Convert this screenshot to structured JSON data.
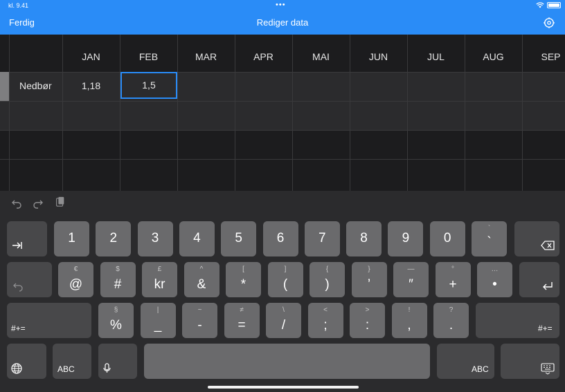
{
  "status": {
    "time": "kl. 9.41",
    "dots": "•••"
  },
  "nav": {
    "done_label": "Ferdig",
    "title": "Rediger data",
    "settings_icon": "gear-icon"
  },
  "table": {
    "months": [
      "JAN",
      "FEB",
      "MAR",
      "APR",
      "MAI",
      "JUN",
      "JUL",
      "AUG",
      "SEP"
    ],
    "rows": [
      {
        "label": "Nedbør",
        "values": [
          "1,18",
          "1,5"
        ]
      }
    ],
    "selected_cell": "FEB"
  },
  "keyboard": {
    "toolbar": [
      "undo-icon",
      "redo-icon",
      "paste-icon"
    ],
    "row1": [
      {
        "main": "1"
      },
      {
        "main": "2"
      },
      {
        "main": "3"
      },
      {
        "main": "4"
      },
      {
        "main": "5"
      },
      {
        "main": "6"
      },
      {
        "main": "7"
      },
      {
        "main": "8"
      },
      {
        "main": "9"
      },
      {
        "main": "0"
      },
      {
        "main": "`",
        "sub": "`"
      }
    ],
    "row2": [
      {
        "main": "@",
        "sub": "€"
      },
      {
        "main": "#",
        "sub": "$"
      },
      {
        "main": "kr",
        "sub": "£"
      },
      {
        "main": "&",
        "sub": "^"
      },
      {
        "main": "*",
        "sub": "["
      },
      {
        "main": "(",
        "sub": "]"
      },
      {
        "main": ")",
        "sub": "{"
      },
      {
        "main": "’",
        "sub": "}"
      },
      {
        "main": "″",
        "sub": "—"
      },
      {
        "main": "+",
        "sub": "°"
      },
      {
        "main": "•",
        "sub": "…"
      }
    ],
    "row3": [
      {
        "main": "%",
        "sub": "§"
      },
      {
        "main": "_",
        "sub": "|"
      },
      {
        "main": "-",
        "sub": "~"
      },
      {
        "main": "=",
        "sub": "≠"
      },
      {
        "main": "/",
        "sub": "\\"
      },
      {
        "main": ";",
        "sub": "<"
      },
      {
        "main": ":",
        "sub": ">"
      },
      {
        "main": ",",
        "sub": "!"
      },
      {
        "main": ".",
        "sub": "?"
      }
    ],
    "shift_label": "#+=",
    "abc_label": "ABC"
  }
}
